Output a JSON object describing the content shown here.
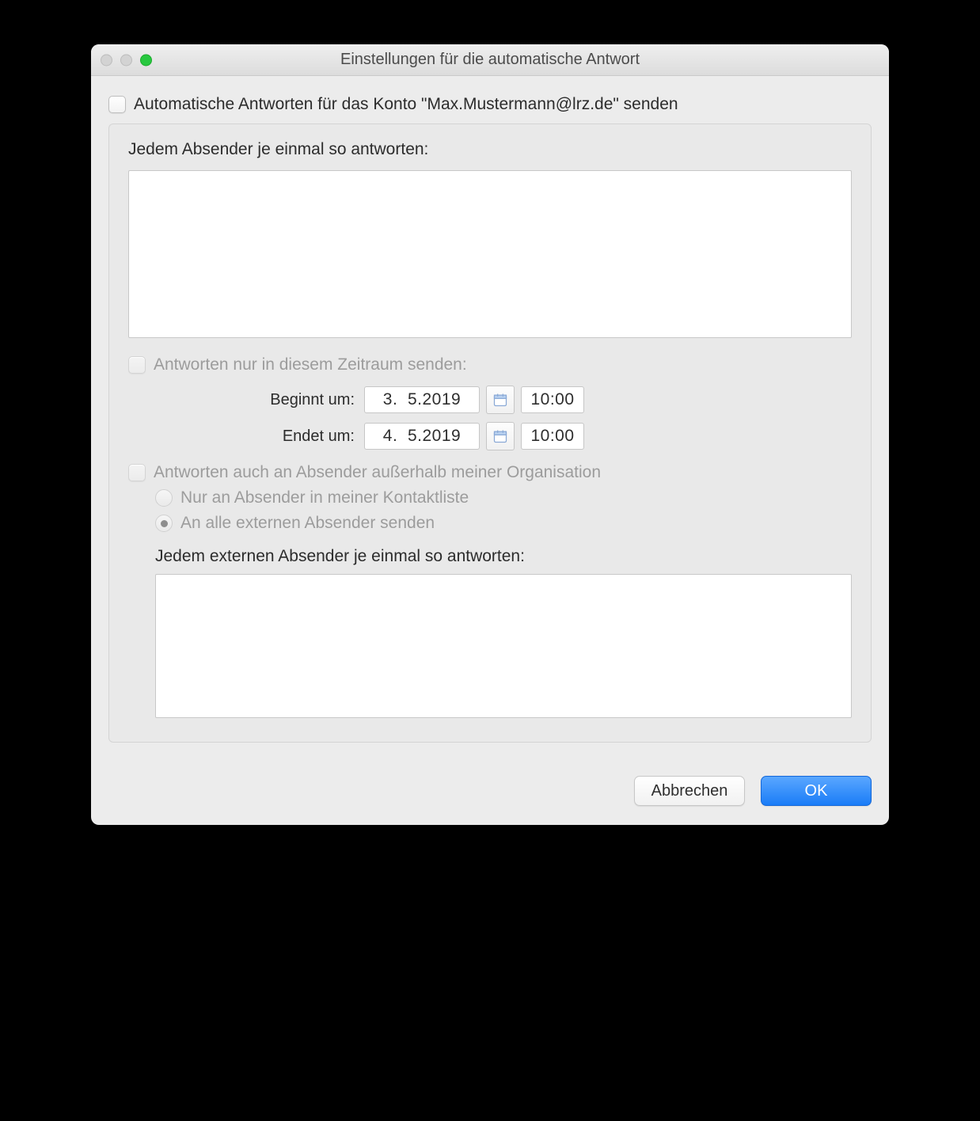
{
  "window": {
    "title": "Einstellungen für die automatische Antwort"
  },
  "enable": {
    "label": "Automatische Antworten für das Konto \"Max.Mustermann@lrz.de\" senden",
    "checked": false
  },
  "internal": {
    "label": "Jedem Absender je einmal so antworten:",
    "value": ""
  },
  "timerange": {
    "label": "Antworten nur in diesem Zeitraum senden:",
    "checked": false,
    "start_label": "Beginnt um:",
    "start_date": "3.  5.2019",
    "start_time": "10:00",
    "end_label": "Endet um:",
    "end_date": "4.  5.2019",
    "end_time": "10:00"
  },
  "external": {
    "enable_label": "Antworten auch an Absender außerhalb meiner Organisation",
    "checked": false,
    "option_contacts": "Nur an Absender in meiner Kontaktliste",
    "option_all": "An alle externen Absender senden",
    "selected": "all",
    "reply_label": "Jedem externen Absender je einmal so antworten:",
    "value": ""
  },
  "buttons": {
    "cancel": "Abbrechen",
    "ok": "OK"
  }
}
